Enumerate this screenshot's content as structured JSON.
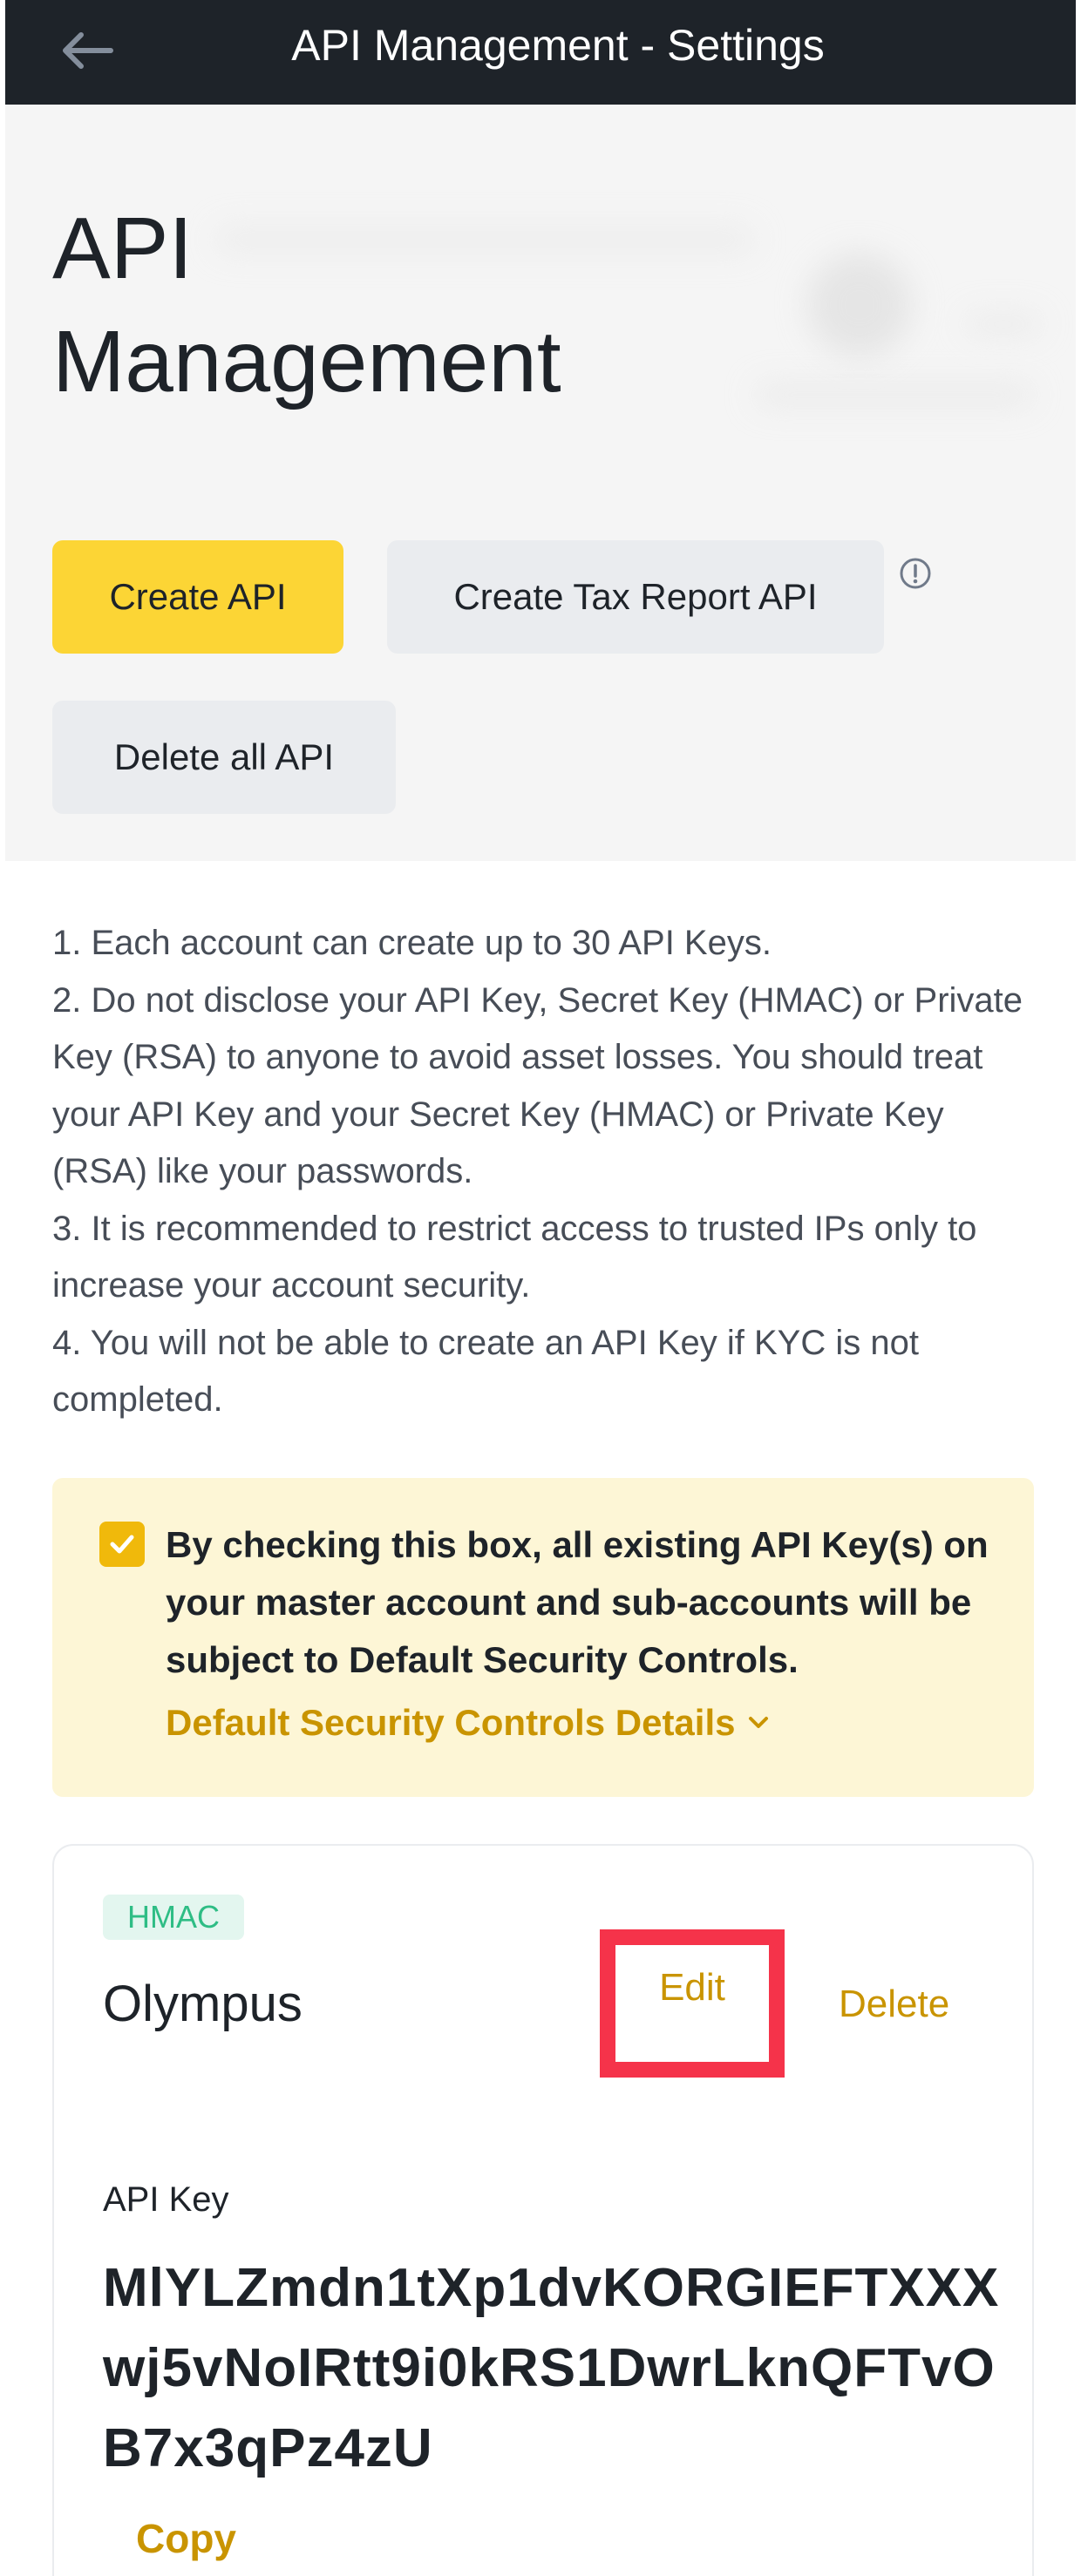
{
  "header": {
    "back_icon": "arrow-left-icon",
    "title": "API Management - Settings"
  },
  "hero": {
    "title": "API Management",
    "create_api_label": "Create API",
    "create_tax_report_label": "Create Tax Report API",
    "info_icon": "info-circle-icon",
    "delete_all_label": "Delete all API"
  },
  "notes": [
    "1. Each account can create up to 30 API Keys.",
    "2. Do not disclose your API Key, Secret Key (HMAC) or Private Key (RSA) to anyone to avoid asset losses. You should treat your API Key and your Secret Key (HMAC) or Private Key (RSA) like your passwords.",
    "3. It is recommended to restrict access to trusted IPs only to increase your account security.",
    "4. You will not be able to create an API Key if KYC is not completed."
  ],
  "consent": {
    "checked": true,
    "text": "By checking this box, all existing API Key(s) on your master account and sub-accounts will be subject to Default Security Controls.",
    "details_link": "Default Security Controls Details",
    "chevron_icon": "chevron-down-icon"
  },
  "api_card": {
    "badge": "HMAC",
    "name": "Olympus",
    "edit_label": "Edit",
    "delete_label": "Delete",
    "key_label": "API Key",
    "key_value": "MlYLZmdn1tXp1dvKORGIEFTXXXwj5vNoIRtt9i0kRS1DwrLknQFTvOB7x3qPz4zU",
    "copy_label": "Copy"
  },
  "colors": {
    "brand_yellow": "#fcd535",
    "link_gold": "#c99400",
    "highlight_red": "#f5334a",
    "badge_green": "#2ebd85",
    "topbar": "#1e2329"
  }
}
